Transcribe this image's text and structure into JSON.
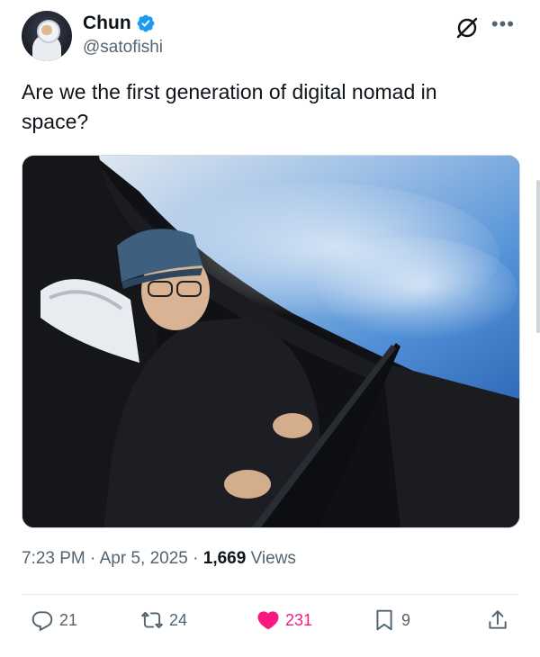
{
  "author": {
    "display_name": "Chun",
    "handle": "@satofishi",
    "verified": true
  },
  "tweet": {
    "text": "Are we the first generation of digital nomad in space?",
    "time": "7:23 PM",
    "date": "Apr 5, 2025",
    "views_count": "1,669",
    "views_label": "Views"
  },
  "actions": {
    "replies": "21",
    "reposts": "24",
    "likes": "231",
    "bookmarks": "9"
  },
  "colors": {
    "verified": "#1d9bf0",
    "like": "#f91880",
    "muted_text": "#536471"
  },
  "icons": [
    "grok-icon",
    "more-icon",
    "reply-icon",
    "repost-icon",
    "heart-icon",
    "bookmark-icon",
    "share-icon",
    "verified-badge-icon"
  ]
}
